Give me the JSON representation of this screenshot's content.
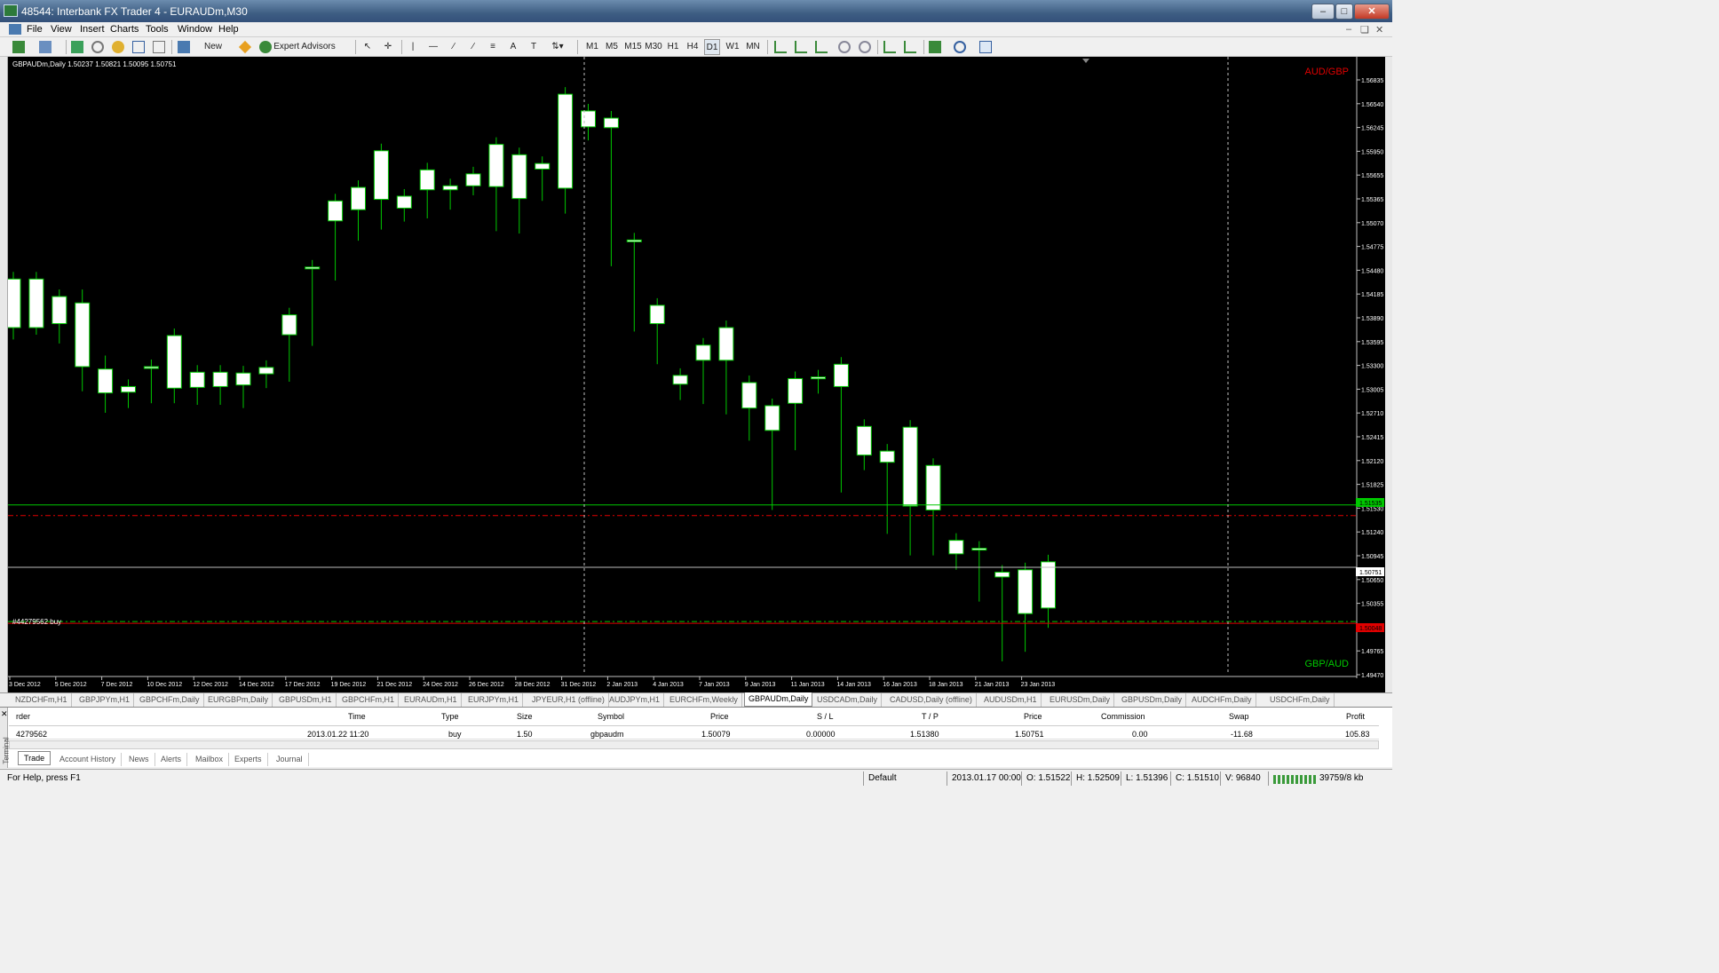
{
  "window": {
    "title": "48544: Interbank FX Trader 4 - EURAUDm,M30"
  },
  "menu": [
    "File",
    "View",
    "Insert",
    "Charts",
    "Tools",
    "Window",
    "Help"
  ],
  "toolbar": {
    "new_order": "New Order",
    "expert_advisors": "Expert Advisors",
    "timeframes": [
      "M1",
      "M5",
      "M15",
      "M30",
      "H1",
      "H4",
      "D1",
      "W1",
      "MN"
    ]
  },
  "chart": {
    "info": "GBPAUDm,Daily  1.50237 1.50821 1.50095 1.50751",
    "corner_top": "AUD/GBP",
    "corner_bottom": "GBP/AUD",
    "order_label": "#44279562 buy",
    "green_line_label": "1.51535",
    "price_line_label": "1.50751",
    "red_line_label": "1.50048",
    "price_scale": [
      "1.56835",
      "1.56540",
      "1.56245",
      "1.55950",
      "1.55655",
      "1.55365",
      "1.55070",
      "1.54775",
      "1.54480",
      "1.54185",
      "1.53890",
      "1.53595",
      "1.53300",
      "1.53005",
      "1.52710",
      "1.52415",
      "1.52120",
      "1.51825",
      "1.51530",
      "1.51240",
      "1.50945",
      "1.50650",
      "1.50355",
      "1.50060",
      "1.49765",
      "1.49470"
    ],
    "date_labels": [
      "3 Dec 2012",
      "5 Dec 2012",
      "7 Dec 2012",
      "10 Dec 2012",
      "12 Dec 2012",
      "14 Dec 2012",
      "17 Dec 2012",
      "19 Dec 2012",
      "21 Dec 2012",
      "24 Dec 2012",
      "26 Dec 2012",
      "28 Dec 2012",
      "31 Dec 2012",
      "2 Jan 2013",
      "4 Jan 2013",
      "7 Jan 2013",
      "9 Jan 2013",
      "11 Jan 2013",
      "14 Jan 2013",
      "16 Jan 2013",
      "18 Jan 2013",
      "21 Jan 2013",
      "23 Jan 2013"
    ]
  },
  "chart_data": {
    "type": "candlestick",
    "symbol": "GBPAUDm,Daily",
    "ylim": [
      1.4947,
      1.5707
    ],
    "candles": [
      {
        "o": 1.5376,
        "h": 1.5427,
        "l": 1.537,
        "c": 1.5437
      },
      {
        "o": 1.5376,
        "h": 1.5398,
        "l": 1.5398,
        "c": 1.5437
      },
      {
        "o": 1.5381,
        "h": 1.5365,
        "l": 1.5413,
        "c": 1.5415
      },
      {
        "o": 1.5327,
        "h": 1.5305,
        "l": 1.5415,
        "c": 1.5407
      },
      {
        "o": 1.5294,
        "h": 1.5278,
        "l": 1.5332,
        "c": 1.5324
      },
      {
        "o": 1.5295,
        "h": 1.5284,
        "l": 1.5302,
        "c": 1.5302
      },
      {
        "o": 1.5327,
        "h": 1.529,
        "l": 1.5297,
        "c": 1.5327
      },
      {
        "o": 1.53,
        "h": 1.529,
        "l": 1.5327,
        "c": 1.5366
      },
      {
        "o": 1.5301,
        "h": 1.5288,
        "l": 1.5299,
        "c": 1.532
      },
      {
        "o": 1.5302,
        "h": 1.5288,
        "l": 1.5303,
        "c": 1.532
      },
      {
        "o": 1.5304,
        "h": 1.5284,
        "l": 1.5304,
        "c": 1.5319
      },
      {
        "o": 1.5318,
        "h": 1.5309,
        "l": 1.5326,
        "c": 1.5326
      },
      {
        "o": 1.5367,
        "h": 1.5317,
        "l": 1.5326,
        "c": 1.5392
      },
      {
        "o": 1.545,
        "h": 1.5362,
        "l": 1.5367,
        "c": 1.5452
      },
      {
        "o": 1.551,
        "h": 1.5444,
        "l": 1.5449,
        "c": 1.5535
      },
      {
        "o": 1.5524,
        "h": 1.5494,
        "l": 1.5511,
        "c": 1.5552
      },
      {
        "o": 1.5537,
        "h": 1.5508,
        "l": 1.5524,
        "c": 1.5598
      },
      {
        "o": 1.5526,
        "h": 1.5518,
        "l": 1.5527,
        "c": 1.5541
      },
      {
        "o": 1.5549,
        "h": 1.5522,
        "l": 1.5532,
        "c": 1.5574
      },
      {
        "o": 1.5549,
        "h": 1.5533,
        "l": 1.5536,
        "c": 1.5554
      },
      {
        "o": 1.5554,
        "h": 1.5551,
        "l": 1.5551,
        "c": 1.5569
      },
      {
        "o": 1.5553,
        "h": 1.5506,
        "l": 1.5538,
        "c": 1.5606
      },
      {
        "o": 1.5538,
        "h": 1.5503,
        "l": 1.5538,
        "c": 1.5593
      },
      {
        "o": 1.5575,
        "h": 1.5544,
        "l": 1.555,
        "c": 1.5582
      },
      {
        "o": 1.5551,
        "h": 1.5528,
        "l": 1.5551,
        "c": 1.5669
      },
      {
        "o": 1.5628,
        "h": 1.562,
        "l": 1.5622,
        "c": 1.5648
      },
      {
        "o": 1.5627,
        "h": 1.5462,
        "l": 1.5483,
        "c": 1.5639
      },
      {
        "o": 1.5486,
        "h": 1.538,
        "l": 1.538,
        "c": 1.5486
      },
      {
        "o": 1.5381,
        "h": 1.5339,
        "l": 1.5339,
        "c": 1.5404
      },
      {
        "o": 1.5305,
        "h": 1.5294,
        "l": 1.5294,
        "c": 1.5316
      },
      {
        "o": 1.5335,
        "h": 1.5289,
        "l": 1.5308,
        "c": 1.5354
      },
      {
        "o": 1.5335,
        "h": 1.5276,
        "l": 1.5276,
        "c": 1.5376
      },
      {
        "o": 1.5275,
        "h": 1.5243,
        "l": 1.5243,
        "c": 1.5307
      },
      {
        "o": 1.5247,
        "h": 1.5156,
        "l": 1.5277,
        "c": 1.5278
      },
      {
        "o": 1.5281,
        "h": 1.5231,
        "l": 1.5305,
        "c": 1.5312
      },
      {
        "o": 1.5314,
        "h": 1.5302,
        "l": 1.5302,
        "c": 1.5314
      },
      {
        "o": 1.5302,
        "h": 1.5178,
        "l": 1.5218,
        "c": 1.533
      },
      {
        "o": 1.5216,
        "h": 1.5208,
        "l": 1.5206,
        "c": 1.5252
      },
      {
        "o": 1.5207,
        "h": 1.5126,
        "l": 1.5155,
        "c": 1.5221
      },
      {
        "o": 1.5152,
        "h": 1.5099,
        "l": 1.5152,
        "c": 1.5251
      },
      {
        "o": 1.5147,
        "h": 1.5099,
        "l": 1.5101,
        "c": 1.5203
      },
      {
        "o": 1.5092,
        "h": 1.5081,
        "l": 1.5092,
        "c": 1.5109
      },
      {
        "o": 1.5097,
        "h": 1.5041,
        "l": 1.5061,
        "c": 1.5099
      },
      {
        "o": 1.5063,
        "h": 1.4966,
        "l": 1.5063,
        "c": 1.5069
      },
      {
        "o": 1.5017,
        "h": 1.4978,
        "l": 1.5017,
        "c": 1.5072
      },
      {
        "o": 1.5024,
        "h": 1.5008,
        "l": 1.5075,
        "c": 1.5082
      }
    ],
    "lines": {
      "green": 1.51535,
      "red_dash": 1.514,
      "gray": 1.50751,
      "red_solid": 1.50048,
      "order_dash": 1.5007
    }
  },
  "chart_tabs": [
    "NZDCHFm,H1",
    "GBPJPYm,H1",
    "GBPCHFm,Daily",
    "EURGBPm,Daily",
    "GBPUSDm,H1",
    "GBPCHFm,H1",
    "EURAUDm,H1",
    "EURJPYm,H1",
    "JPYEUR,H1 (offline)",
    "AUDJPYm,H1",
    "EURCHFm,Weekly",
    "GBPAUDm,Daily",
    "USDCADm,Daily",
    "CADUSD,Daily (offline)",
    "AUDUSDm,H1",
    "EURUSDm,Daily",
    "GBPUSDm,Daily",
    "AUDCHFm,Daily",
    "USDCHFm,Daily"
  ],
  "terminal": {
    "side_label": "Terminal",
    "headers": [
      "rder",
      "Time",
      "Type",
      "Size",
      "Symbol",
      "Price",
      "S / L",
      "T / P",
      "Price",
      "Commission",
      "Swap",
      "Profit"
    ],
    "row": [
      "4279562",
      "2013.01.22 11:20",
      "buy",
      "1.50",
      "gbpaudm",
      "1.50079",
      "0.00000",
      "1.51380",
      "1.50751",
      "0.00",
      "-11.68",
      "105.83"
    ],
    "tabs": [
      "Trade",
      "Account History",
      "News",
      "Alerts",
      "Mailbox",
      "Experts",
      "Journal"
    ]
  },
  "status": {
    "help": "For Help, press F1",
    "profile": "Default",
    "datetime": "2013.01.17 00:00",
    "open": "O: 1.51522",
    "high": "H: 1.52509",
    "low": "L: 1.51396",
    "close": "C: 1.51510",
    "volume": "V: 96840",
    "traffic": "39759/8 kb"
  },
  "colors": {
    "bull": "#ffffff",
    "wick": "#00c800",
    "green_line": "#00c800",
    "red_line": "#e00000",
    "corner_top": "#e00000",
    "corner_bottom": "#00c800"
  }
}
